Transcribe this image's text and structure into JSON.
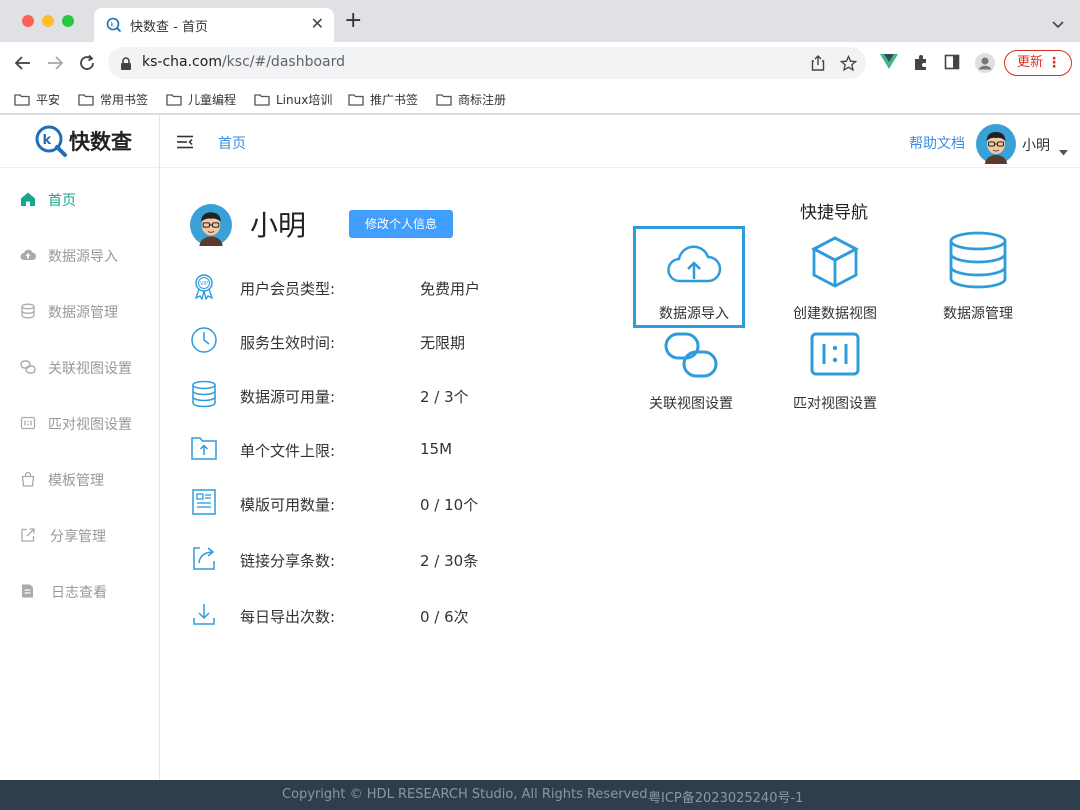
{
  "browser": {
    "tab_title": "快数查 - 首页",
    "url_host": "ks-cha.com",
    "url_path": "/ksc/#/dashboard",
    "update_label": "更新",
    "bookmarks": [
      "平安",
      "常用书签",
      "儿童编程",
      "Linux培训",
      "推广书签",
      "商标注册"
    ]
  },
  "app": {
    "logo_text": "快数查",
    "breadcrumb": "首页",
    "help_label": "帮助文档",
    "username": "小明",
    "accent_color": "#17a68a",
    "link_color": "#3a8ee6",
    "button_color": "#409eff"
  },
  "sidebar": {
    "items": [
      {
        "label": "首页",
        "icon": "home-icon",
        "active": true
      },
      {
        "label": "数据源导入",
        "icon": "cloud-upload-icon"
      },
      {
        "label": "数据源管理",
        "icon": "database-icon"
      },
      {
        "label": "关联视图设置",
        "icon": "link-icon"
      },
      {
        "label": "匹对视图设置",
        "icon": "match-icon"
      },
      {
        "label": "模板管理",
        "icon": "bag-icon"
      },
      {
        "label": "分享管理",
        "icon": "share-icon"
      },
      {
        "label": "日志查看",
        "icon": "log-icon"
      }
    ]
  },
  "profile": {
    "name": "小明",
    "edit_label": "修改个人信息",
    "rows": [
      {
        "label": "用户会员类型:",
        "value": "免费用户",
        "icon": "vip-badge-icon"
      },
      {
        "label": "服务生效时间:",
        "value": "无限期",
        "icon": "clock-icon"
      },
      {
        "label": "数据源可用量:",
        "value": "2 / 3个",
        "icon": "database-icon"
      },
      {
        "label": "单个文件上限:",
        "value": "15M",
        "icon": "folder-upload-icon"
      },
      {
        "label": "模版可用数量:",
        "value": "0 / 10个",
        "icon": "template-icon"
      },
      {
        "label": "链接分享条数:",
        "value": "2 / 30条",
        "icon": "share-icon"
      },
      {
        "label": "每日导出次数:",
        "value": "0 / 6次",
        "icon": "download-icon"
      }
    ]
  },
  "quick_nav": {
    "title": "快捷导航",
    "items": [
      {
        "label": "数据源导入",
        "icon": "cloud-upload-icon",
        "selected": true
      },
      {
        "label": "创建数据视图",
        "icon": "cube-icon"
      },
      {
        "label": "数据源管理",
        "icon": "database-icon"
      },
      {
        "label": "关联视图设置",
        "icon": "link-icon"
      },
      {
        "label": "匹对视图设置",
        "icon": "match-icon"
      }
    ]
  },
  "footer": {
    "copyright": "Copyright © HDL RESEARCH Studio, All Rights Reserved",
    "icp": "粤ICP备2023025240号-1"
  }
}
